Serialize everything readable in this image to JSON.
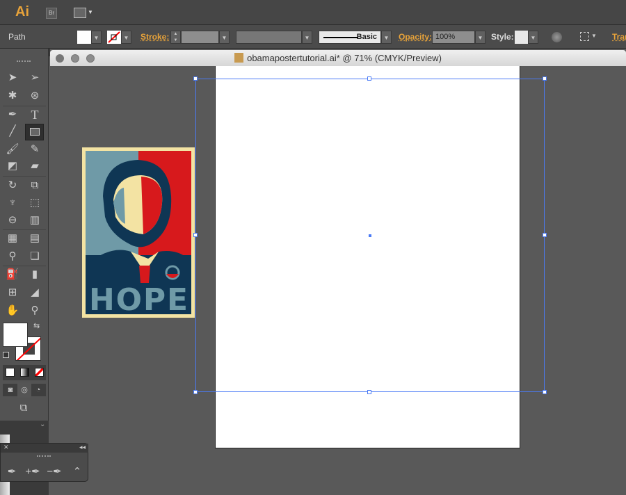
{
  "app": {
    "logo": "Ai",
    "bridge": "Br"
  },
  "control": {
    "selection_type": "Path",
    "stroke_label": "Stroke:",
    "brush": "Basic",
    "opacity_label": "Opacity:",
    "opacity_value": "100%",
    "style_label": "Style:",
    "transform_label": "Tran"
  },
  "document": {
    "title": "obamapostertutorial.ai* @ 71% (CMYK/Preview)"
  },
  "poster": {
    "text": "HOPE"
  },
  "colors": {
    "accent": "#e8a33a",
    "selection": "#4b7bf5",
    "poster_red": "#d7191c",
    "poster_navy": "#0f3654",
    "poster_blue": "#6f9aa7",
    "poster_cream": "#f3e3a3"
  }
}
